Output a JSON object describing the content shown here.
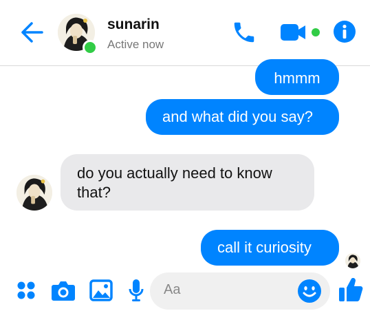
{
  "header": {
    "contact_name": "sunarin",
    "status": "Active now"
  },
  "messages": [
    {
      "direction": "outgoing",
      "text": "hmmm"
    },
    {
      "direction": "outgoing",
      "text": "and what did you say?"
    },
    {
      "direction": "incoming",
      "text": "do you actually need to know that?"
    },
    {
      "direction": "outgoing",
      "text": "call it curiosity"
    }
  ],
  "composer": {
    "placeholder": "Aa"
  },
  "colors": {
    "accent": "#0084ff",
    "online": "#31cc46",
    "incoming_bubble": "#e9e9eb"
  },
  "icons": [
    "back-arrow-icon",
    "phone-icon",
    "video-camera-icon",
    "info-icon",
    "apps-grid-icon",
    "camera-icon",
    "image-icon",
    "microphone-icon",
    "emoji-icon",
    "like-thumb-icon"
  ]
}
